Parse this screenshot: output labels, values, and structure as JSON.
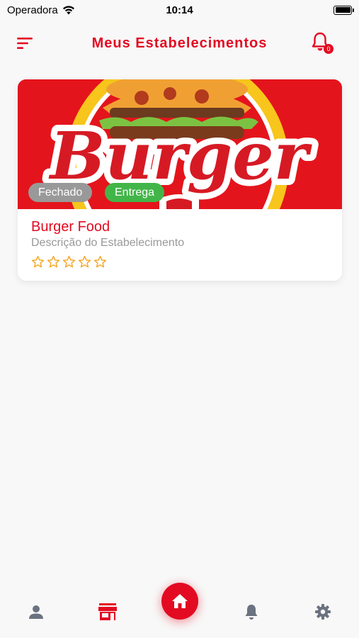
{
  "status_bar": {
    "carrier": "Operadora",
    "time": "10:14"
  },
  "header": {
    "title": "Meus Estabelecimentos",
    "notification_count": "0"
  },
  "establishments": [
    {
      "banner_text": "Burger",
      "name": "Burger Food",
      "description": "Descrição do Estabelecimento",
      "status_tag": "Fechado",
      "service_tag": "Entrega",
      "rating": 0,
      "rating_max": 5
    }
  ],
  "bottom_nav": {
    "items": [
      "profile-icon",
      "store-icon",
      "home-icon",
      "bell-icon",
      "gear-icon"
    ],
    "active": "store-icon"
  },
  "colors": {
    "brand": "#e30b21",
    "tag_closed": "#999999",
    "tag_delivery": "#42b549",
    "star": "#f5a623",
    "nav_inactive": "#6b7280"
  }
}
